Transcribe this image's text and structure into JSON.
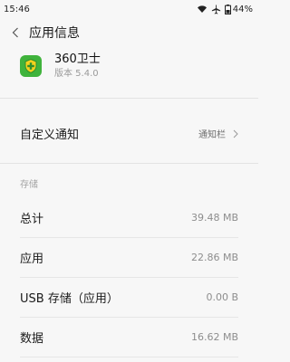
{
  "status_bar": {
    "time": "15:46",
    "battery_percent": "44%",
    "icons": [
      "wifi-icon",
      "airplane-icon",
      "battery-icon"
    ]
  },
  "nav": {
    "title": "应用信息"
  },
  "app": {
    "name": "360卫士",
    "version": "版本 5.4.0",
    "icon": "360-security-app-icon",
    "icon_color": "#40b33c"
  },
  "notifications": {
    "label": "自定义通知",
    "value": "通知栏"
  },
  "storage": {
    "section_label": "存储",
    "rows": [
      {
        "label": "总计",
        "value": "39.48 MB"
      },
      {
        "label": "应用",
        "value": "22.86 MB"
      },
      {
        "label": "USB 存储（应用）",
        "value": "0.00 B"
      },
      {
        "label": "数据",
        "value": "16.62 MB"
      }
    ]
  }
}
